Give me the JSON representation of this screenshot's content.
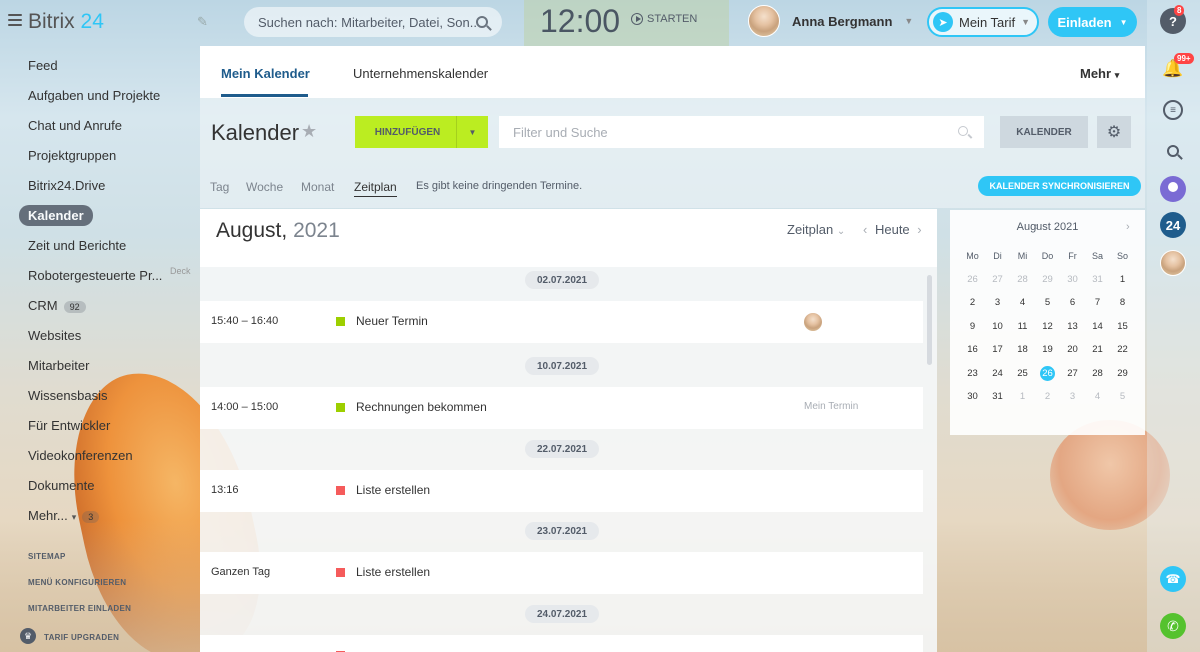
{
  "topbar": {
    "logo_text": "Bitrix",
    "logo_num": "24",
    "search_placeholder": "Suchen nach: Mitarbeiter, Datei, Son...",
    "clock_time": "12:00",
    "clock_start": "STARTEN",
    "user_name": "Anna Bergmann",
    "tarif_label": "Mein Tarif",
    "invite_label": "Einladen"
  },
  "right_rail": {
    "help_badge": "8",
    "bell_badge": "99+",
    "counter_24": "24"
  },
  "sidebar": {
    "items": [
      {
        "label": "Feed"
      },
      {
        "label": "Aufgaben und Projekte"
      },
      {
        "label": "Chat und Anrufe"
      },
      {
        "label": "Projektgruppen"
      },
      {
        "label": "Bitrix24.Drive"
      },
      {
        "label": "Kalender"
      },
      {
        "label": "Zeit und Berichte"
      },
      {
        "label": "Robotergesteuerte Pr..."
      },
      {
        "label": "CRM",
        "counter": "92"
      },
      {
        "label": "Websites"
      },
      {
        "label": "Mitarbeiter"
      },
      {
        "label": "Wissensbasis"
      },
      {
        "label": "Für Entwickler"
      },
      {
        "label": "Videokonferenzen"
      },
      {
        "label": "Dokumente"
      },
      {
        "label": "Mehr...",
        "counter": "3"
      }
    ],
    "deck_tag": "Deck",
    "footer": {
      "sitemap": "SITEMAP",
      "configure_menu": "MENÜ KONFIGURIEREN",
      "invite_staff": "MITARBEITER EINLADEN",
      "upgrade_plan": "TARIF UPGRADEN"
    }
  },
  "main_tabs": {
    "tab1": "Mein Kalender",
    "tab2": "Unternehmenskalender",
    "more": "Mehr"
  },
  "toolbar": {
    "title": "Kalender",
    "add_label": "HINZUFÜGEN",
    "filter_placeholder": "Filter und Suche",
    "calendar_label": "KALENDER",
    "views": [
      "Tag",
      "Woche",
      "Monat",
      "Zeitplan"
    ],
    "no_events": "Es gibt keine dringenden Termine.",
    "sync_label": "KALENDER SYNCHRONISIEREN"
  },
  "schedule": {
    "month": "August,",
    "year": "2021",
    "view_label": "Zeitplan",
    "today_label": "Heute",
    "groups": [
      {
        "date": "02.07.2021",
        "time": "15:40 – 16:40",
        "title": "Neuer Termin",
        "color": "#9dcf00",
        "owner": ""
      },
      {
        "date": "10.07.2021",
        "time": "14:00 – 15:00",
        "title": "Rechnungen bekommen",
        "color": "#9dcf00",
        "owner": "Mein Termin"
      },
      {
        "date": "22.07.2021",
        "time": "13:16",
        "title": "Liste erstellen",
        "color": "#f55b5b",
        "owner": ""
      },
      {
        "date": "23.07.2021",
        "time": "Ganzen Tag",
        "title": "Liste erstellen",
        "color": "#f55b5b",
        "owner": ""
      },
      {
        "date": "24.07.2021",
        "time": "",
        "title": "",
        "color": "#f55b5b",
        "owner": ""
      }
    ]
  },
  "mini_calendar": {
    "title": "August 2021",
    "days_of_week": [
      "Mo",
      "Di",
      "Mi",
      "Do",
      "Fr",
      "Sa",
      "So"
    ],
    "weeks": [
      [
        "26",
        "27",
        "28",
        "29",
        "30",
        "31",
        "1"
      ],
      [
        "2",
        "3",
        "4",
        "5",
        "6",
        "7",
        "8"
      ],
      [
        "9",
        "10",
        "11",
        "12",
        "13",
        "14",
        "15"
      ],
      [
        "16",
        "17",
        "18",
        "19",
        "20",
        "21",
        "22"
      ],
      [
        "23",
        "24",
        "25",
        "26",
        "27",
        "28",
        "29"
      ],
      [
        "30",
        "31",
        "1",
        "2",
        "3",
        "4",
        "5"
      ]
    ],
    "today": "26"
  },
  "colors": {
    "accent": "#2fc6f6",
    "add_button": "#bbed21",
    "active_tab": "#1f5c8c"
  }
}
